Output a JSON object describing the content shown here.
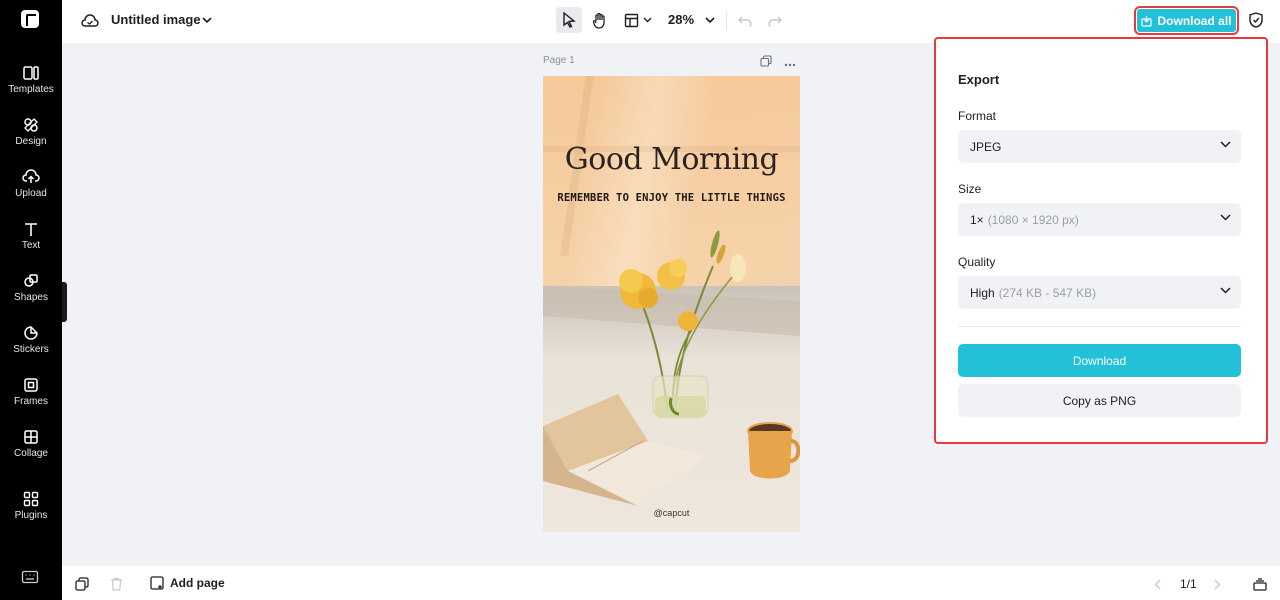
{
  "sidebar": {
    "items": [
      {
        "label": "Templates",
        "icon": "templates-icon"
      },
      {
        "label": "Design",
        "icon": "design-icon"
      },
      {
        "label": "Upload",
        "icon": "upload-icon"
      },
      {
        "label": "Text",
        "icon": "text-icon"
      },
      {
        "label": "Shapes",
        "icon": "shapes-icon"
      },
      {
        "label": "Stickers",
        "icon": "stickers-icon"
      },
      {
        "label": "Frames",
        "icon": "frames-icon"
      },
      {
        "label": "Collage",
        "icon": "collage-icon"
      },
      {
        "label": "Plugins",
        "icon": "plugins-icon"
      }
    ]
  },
  "topbar": {
    "title": "Untitled image",
    "zoom": "28%",
    "download_all": "Download all"
  },
  "canvas": {
    "page_label": "Page 1",
    "headline": "Good Morning",
    "subhead": "REMEMBER TO ENJOY THE LITTLE THINGS",
    "handle": "@capcut"
  },
  "export": {
    "title": "Export",
    "format_label": "Format",
    "format_value": "JPEG",
    "size_label": "Size",
    "size_value": "1×",
    "size_detail": "(1080 × 1920 px)",
    "quality_label": "Quality",
    "quality_value": "High",
    "quality_detail": "(274 KB - 547 KB)",
    "download_button": "Download",
    "copy_button": "Copy as PNG"
  },
  "bottombar": {
    "add_page": "Add page",
    "pager": "1/1"
  },
  "colors": {
    "accent": "#22c1d8",
    "highlight": "#e8393f",
    "sidebar": "#000000"
  }
}
